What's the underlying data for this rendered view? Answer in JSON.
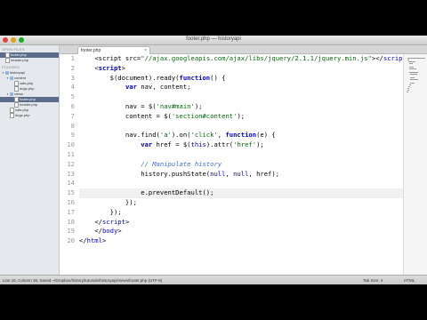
{
  "window": {
    "title": "footer.php — historyapi"
  },
  "sidebar": {
    "open_files_header": "OPEN FILES",
    "open_files": [
      {
        "label": "footer.php",
        "selected": true,
        "kind": "file"
      },
      {
        "label": "header.php",
        "selected": false,
        "kind": "file"
      }
    ],
    "folders_header": "FOLDERS",
    "tree": [
      {
        "label": "historyapi",
        "depth": 0,
        "kind": "folder",
        "arrow": "▼",
        "selected": false
      },
      {
        "label": "content",
        "depth": 1,
        "kind": "folder",
        "arrow": "▼",
        "selected": false
      },
      {
        "label": "cats.php",
        "depth": 2,
        "kind": "file",
        "arrow": "",
        "selected": false
      },
      {
        "label": "dogs.php",
        "depth": 2,
        "kind": "file",
        "arrow": "",
        "selected": false
      },
      {
        "label": "views",
        "depth": 1,
        "kind": "folder",
        "arrow": "▼",
        "selected": false
      },
      {
        "label": "footer.php",
        "depth": 2,
        "kind": "file",
        "arrow": "",
        "selected": true
      },
      {
        "label": "header.php",
        "depth": 2,
        "kind": "file",
        "arrow": "",
        "selected": false
      },
      {
        "label": "cats.php",
        "depth": 1,
        "kind": "file",
        "arrow": "",
        "selected": false
      },
      {
        "label": "dogs.php",
        "depth": 1,
        "kind": "file",
        "arrow": "",
        "selected": false
      }
    ]
  },
  "tab": {
    "label": "footer.php",
    "close": "×"
  },
  "editor": {
    "highlight_line": 15,
    "lines": [
      [
        [
          "    ",
          ""
        ],
        [
          "<script",
          ""
        ],
        [
          " src=",
          ""
        ],
        [
          "\"//ajax.googleapis.com/ajax/libs/jquery/2.1.1/jquery.min.js\"",
          "str"
        ],
        [
          "></",
          ""
        ],
        [
          "script",
          "tg"
        ],
        [
          ">",
          ""
        ]
      ],
      [
        [
          "    <",
          ""
        ],
        [
          "script",
          "kw"
        ],
        [
          ">",
          ""
        ]
      ],
      [
        [
          "        $(document).ready(",
          ""
        ],
        [
          "function",
          "kw"
        ],
        [
          "() {",
          ""
        ]
      ],
      [
        [
          "            ",
          ""
        ],
        [
          "var",
          "kw"
        ],
        [
          " nav, content;",
          ""
        ]
      ],
      [
        [
          "",
          ""
        ]
      ],
      [
        [
          "            nav = $(",
          ""
        ],
        [
          "'nav#main'",
          "str"
        ],
        [
          ");",
          ""
        ]
      ],
      [
        [
          "            content = $(",
          ""
        ],
        [
          "'section#content'",
          "str"
        ],
        [
          ");",
          ""
        ]
      ],
      [
        [
          "",
          ""
        ]
      ],
      [
        [
          "            nav.find(",
          ""
        ],
        [
          "'a'",
          "str"
        ],
        [
          ").on(",
          ""
        ],
        [
          "'click'",
          "str"
        ],
        [
          ", ",
          ""
        ],
        [
          "function",
          "kw"
        ],
        [
          "(e) {",
          ""
        ]
      ],
      [
        [
          "                ",
          ""
        ],
        [
          "var",
          "kw"
        ],
        [
          " href = $(",
          ""
        ],
        [
          "this",
          "fn"
        ],
        [
          ").attr(",
          ""
        ],
        [
          "'href'",
          "str"
        ],
        [
          ");",
          ""
        ]
      ],
      [
        [
          "",
          ""
        ]
      ],
      [
        [
          "                ",
          ""
        ],
        [
          "// Manipulate history",
          "cm"
        ]
      ],
      [
        [
          "                history.pushState(",
          ""
        ],
        [
          "null",
          "fn"
        ],
        [
          ", ",
          ""
        ],
        [
          "null",
          "fn"
        ],
        [
          ", href);",
          ""
        ]
      ],
      [
        [
          "",
          ""
        ]
      ],
      [
        [
          "                e.preventDefault();",
          ""
        ]
      ],
      [
        [
          "            });",
          ""
        ]
      ],
      [
        [
          "        });",
          ""
        ]
      ],
      [
        [
          "    </",
          ""
        ],
        [
          "script",
          "tg"
        ],
        [
          ">",
          ""
        ]
      ],
      [
        [
          "    </",
          ""
        ],
        [
          "body",
          "tg"
        ],
        [
          ">",
          ""
        ]
      ],
      [
        [
          "</",
          ""
        ],
        [
          "html",
          "tg"
        ],
        [
          ">",
          ""
        ]
      ]
    ]
  },
  "status": {
    "left": "Line 15, Column 36; Saved ~/Dropbox/history/tutorials/historyapi/views/footer.php (UTF-8)",
    "tab_size": "Tab Size: 4",
    "syntax": "HTML"
  }
}
